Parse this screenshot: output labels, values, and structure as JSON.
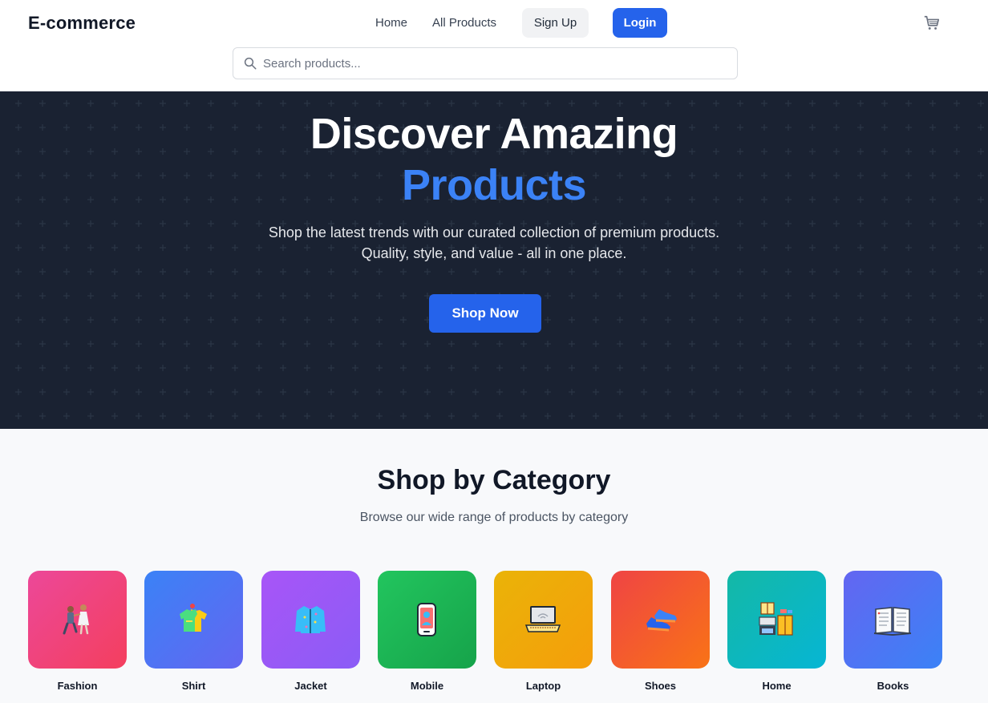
{
  "header": {
    "brand": "E-commerce",
    "nav": {
      "home": "Home",
      "all_products": "All Products"
    },
    "signup_label": "Sign Up",
    "login_label": "Login",
    "search_placeholder": "Search products..."
  },
  "hero": {
    "title_line1": "Discover Amazing",
    "title_line2": "Products",
    "subtitle_line1": "Shop the latest trends with our curated collection of premium products.",
    "subtitle_line2": "Quality, style, and value - all in one place.",
    "cta_label": "Shop Now"
  },
  "categories": {
    "title": "Shop by Category",
    "subtitle": "Browse our wide range of products by category",
    "items": [
      {
        "label": "Fashion",
        "icon": "couple-icon"
      },
      {
        "label": "Shirt",
        "icon": "shirt-icon"
      },
      {
        "label": "Jacket",
        "icon": "jacket-icon"
      },
      {
        "label": "Mobile",
        "icon": "mobile-icon"
      },
      {
        "label": "Laptop",
        "icon": "laptop-icon"
      },
      {
        "label": "Shoes",
        "icon": "shoes-icon"
      },
      {
        "label": "Home",
        "icon": "home-furniture-icon"
      },
      {
        "label": "Books",
        "icon": "book-icon"
      }
    ]
  },
  "colors": {
    "accent": "#2563eb",
    "hero_bg": "#1a2232",
    "hero_highlight": "#3b82f6"
  }
}
